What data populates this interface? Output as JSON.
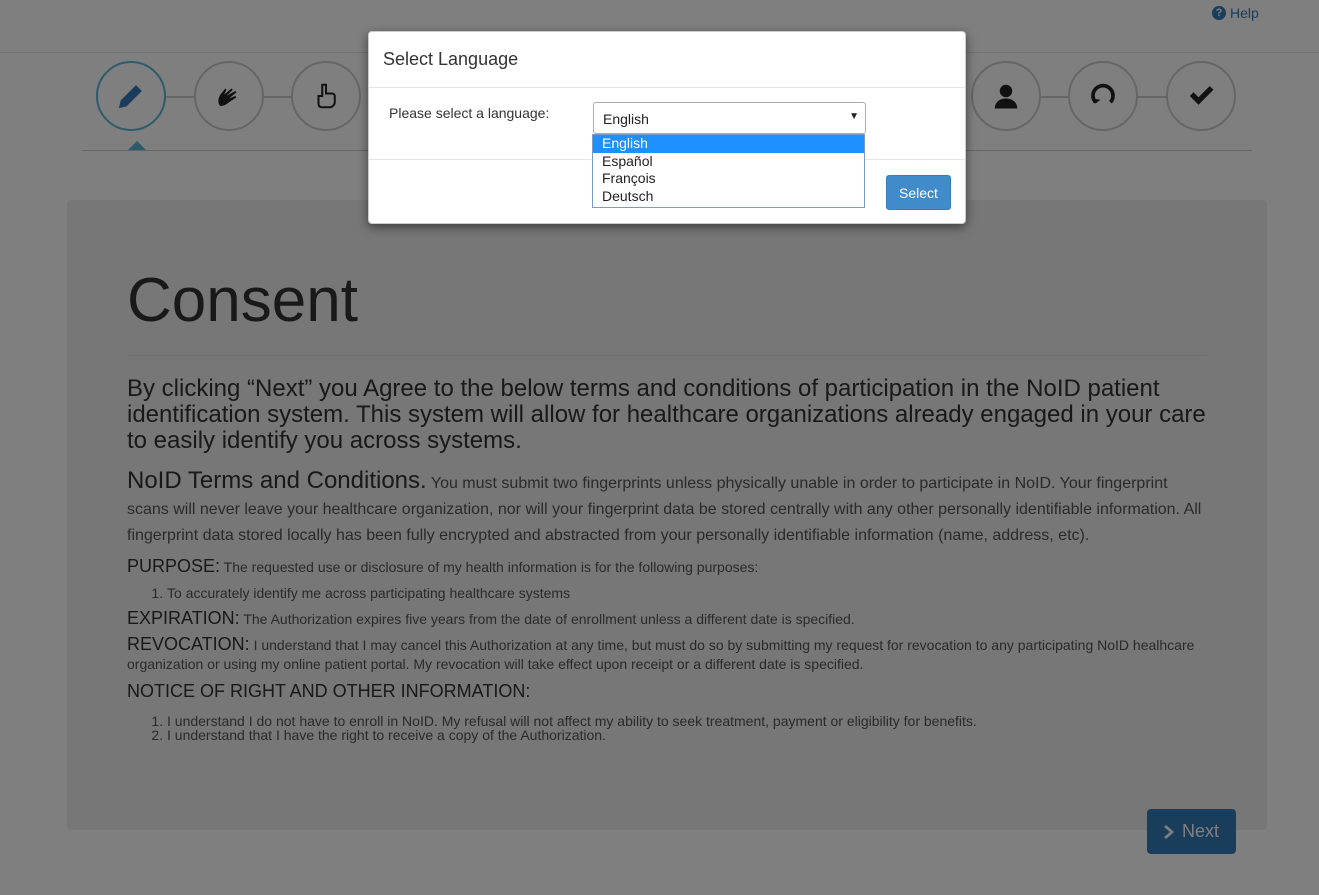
{
  "header": {
    "help_label": "Help",
    "help_icon": "question-circle-icon"
  },
  "steps": [
    {
      "name": "consent",
      "icon": "pencil-icon",
      "active": true
    },
    {
      "name": "sign-language",
      "icon": "hands-icon",
      "active": false
    },
    {
      "name": "fingerprint",
      "icon": "hand-pointer-icon",
      "active": false
    },
    {
      "name": "profile",
      "icon": "user-icon",
      "active": false
    },
    {
      "name": "retry",
      "icon": "refresh-icon",
      "active": false
    },
    {
      "name": "complete",
      "icon": "check-icon",
      "active": false
    }
  ],
  "content": {
    "title": "Consent",
    "lead": "By clicking “Next” you Agree to the below terms and conditions of participation in the NoID patient identification system. This system will allow for healthcare organizations already engaged in your care to easily identify you across systems.",
    "terms_heading": "NoID Terms and Conditions.",
    "terms_text": "You must submit two fingerprints unless physically unable in order to participate in NoID. Your fingerprint scans will never leave your healthcare organization, nor will your fingerprint data be stored centrally with any other personally identifiable information. All fingerprint data stored locally has been fully encrypted and abstracted from your personally identifiable information (name, address, etc).",
    "purpose_heading": "PURPOSE:",
    "purpose_text": "The requested use or disclosure of my health information is for the following purposes:",
    "purpose_items": [
      "To accurately identify me across participating healthcare systems"
    ],
    "expiration_heading": "EXPIRATION:",
    "expiration_text": "The Authorization expires five years from the date of enrollment unless a different date is specified.",
    "revocation_heading": "REVOCATION:",
    "revocation_text": "I understand that I may cancel this Authorization at any time, but must do so by submitting my request for revocation to any participating NoID healhcare organization or using my online patient portal. My revocation will take effect upon receipt or a different date is specified.",
    "notice_heading": "NOTICE OF RIGHT AND OTHER INFORMATION:",
    "notice_items": [
      "I understand I do not have to enroll in NoID. My refusal will not affect my ability to seek treatment, payment or eligibility for benefits.",
      "I understand that I have the right to receive a copy of the Authorization."
    ],
    "next_label": "Next"
  },
  "modal": {
    "title": "Select Language",
    "label": "Please select a language:",
    "selected_value": "English",
    "options": [
      "English",
      "Español",
      "François",
      "Deutsch"
    ],
    "highlighted_option": "English",
    "select_button": "Select"
  },
  "colors": {
    "accent": "#337ab7",
    "active_step": "#5bb7d5",
    "highlight": "#1e90ff"
  }
}
